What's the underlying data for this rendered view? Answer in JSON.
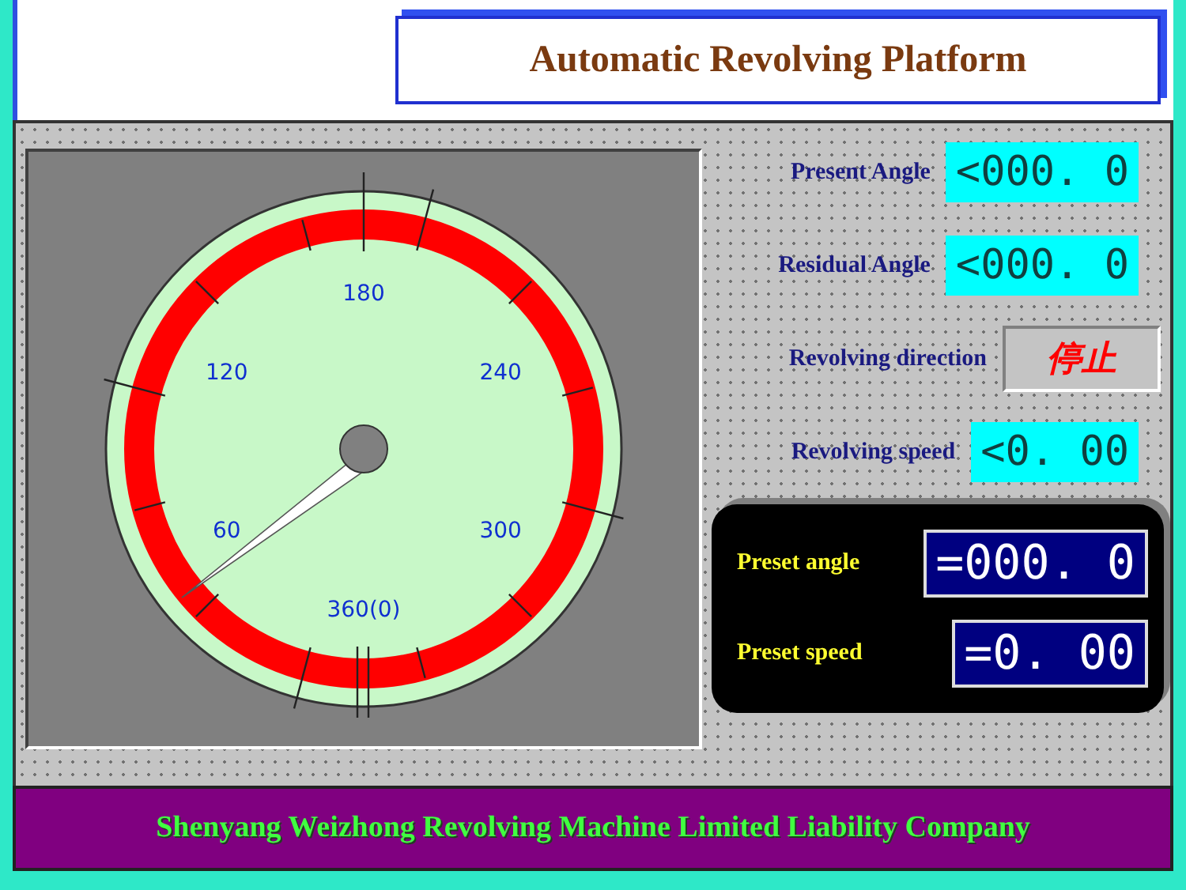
{
  "title": "Automatic Revolving Platform",
  "gauge": {
    "scale_labels": [
      "360(0)",
      "60",
      "120",
      "180",
      "240",
      "300"
    ]
  },
  "readouts": [
    {
      "label": "Present Angle",
      "value": "<000. 0",
      "kind": "numeric"
    },
    {
      "label": "Residual Angle",
      "value": "<000. 0",
      "kind": "numeric"
    },
    {
      "label": "Revolving direction",
      "value": "停止",
      "kind": "status"
    },
    {
      "label": "Revolving speed",
      "value": "<0. 00",
      "kind": "numeric"
    }
  ],
  "presets": [
    {
      "label": "Preset angle",
      "value": "=000. 0"
    },
    {
      "label": "Preset speed",
      "value": "=0. 00"
    }
  ],
  "footer": "Shenyang Weizhong Revolving Machine Limited Liability Company"
}
